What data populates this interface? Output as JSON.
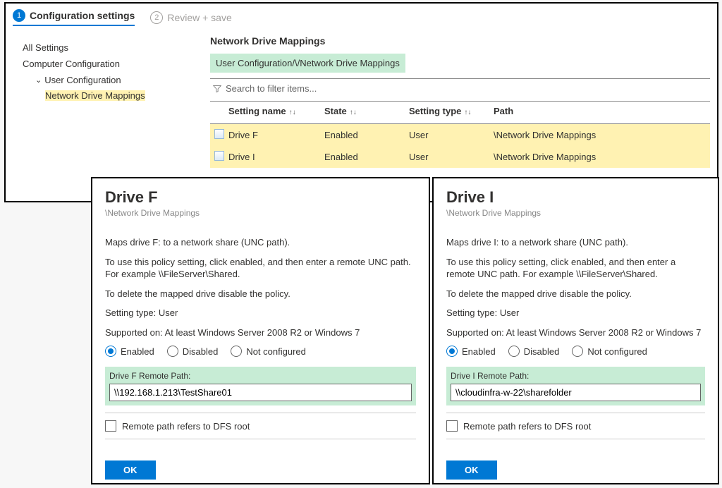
{
  "steps": {
    "step1": "Configuration settings",
    "step2": "Review + save"
  },
  "sidebar": {
    "all": "All Settings",
    "comp": "Computer Configuration",
    "user": "User Configuration",
    "ndm": "Network Drive Mappings"
  },
  "main": {
    "title": "Network Drive Mappings",
    "breadcrumb": "User Configuration/\\/Network Drive Mappings",
    "search_ph": "Search to filter items...",
    "cols": {
      "name": "Setting name",
      "state": "State",
      "type": "Setting type",
      "path": "Path"
    },
    "rows": [
      {
        "name": "Drive F",
        "state": "Enabled",
        "type": "User",
        "path": "\\Network Drive Mappings"
      },
      {
        "name": "Drive I",
        "state": "Enabled",
        "type": "User",
        "path": "\\Network Drive Mappings"
      }
    ]
  },
  "panel_common": {
    "subpath": "\\Network Drive Mappings",
    "p2": "To use this policy setting, click enabled, and then enter a remote UNC path.  For example \\\\FileServer\\Shared.",
    "p3": "To delete the mapped drive disable the policy.",
    "p4": "Setting type: User",
    "p5": "Supported on: At least Windows Server 2008 R2 or Windows 7",
    "enabled": "Enabled",
    "disabled": "Disabled",
    "notconf": "Not configured",
    "dfs": "Remote path refers to DFS root",
    "ok": "OK"
  },
  "panelF": {
    "title": "Drive F",
    "p1": "Maps drive F: to a network share (UNC path).",
    "rp_label": "Drive F Remote Path:",
    "rp_value": "\\\\192.168.1.213\\TestShare01"
  },
  "panelI": {
    "title": "Drive I",
    "p1": "Maps drive I: to a network share (UNC path).",
    "rp_label": "Drive I Remote Path:",
    "rp_value": "\\\\cloudinfra-w-22\\sharefolder"
  }
}
